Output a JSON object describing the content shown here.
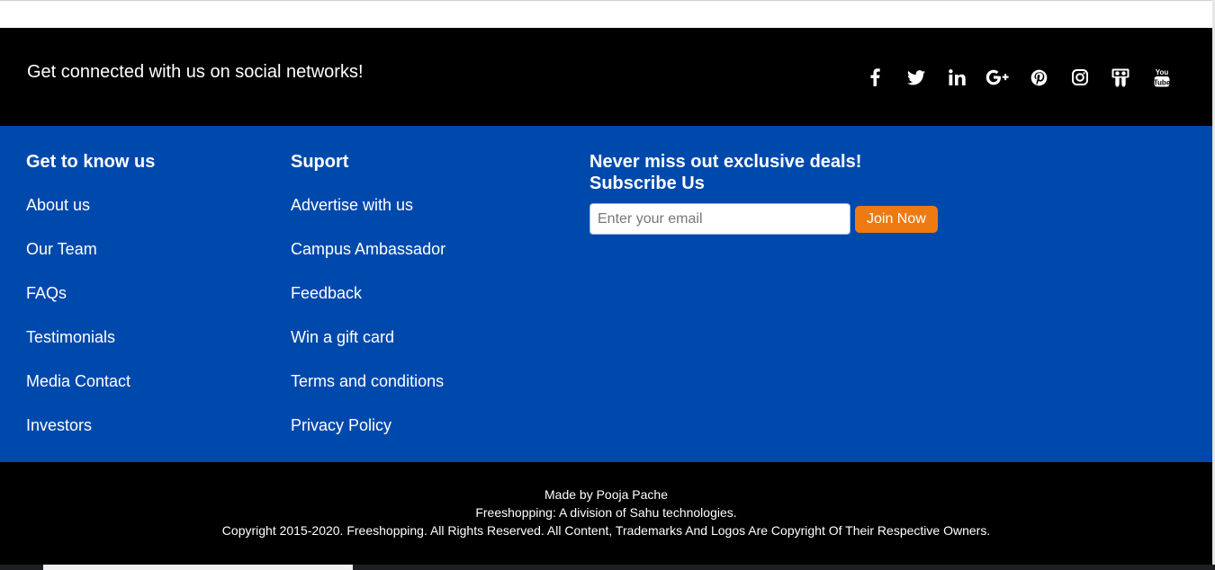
{
  "social": {
    "text": "Get connected with us on social networks!",
    "icons": [
      "facebook-icon",
      "twitter-icon",
      "linkedin-icon",
      "google-plus-icon",
      "pinterest-icon",
      "instagram-icon",
      "slideshare-icon",
      "youtube-icon"
    ]
  },
  "columns": {
    "know_us": {
      "heading": "Get to know us",
      "items": [
        "About us",
        "Our Team",
        "FAQs",
        "Testimonials",
        "Media Contact",
        "Investors"
      ]
    },
    "support": {
      "heading": "Suport",
      "items": [
        "Advertise with us",
        "Campus Ambassador",
        "Feedback",
        "Win a gift card",
        "Terms and conditions",
        "Privacy Policy"
      ]
    }
  },
  "newsletter": {
    "deals_heading": "Never miss out exclusive deals!",
    "subscribe_heading": "Subscribe Us",
    "email_placeholder": "Enter your email",
    "join_label": "Join Now"
  },
  "footer": {
    "made_by": "Made by Pooja Pache",
    "division": "Freeshopping: A division of Sahu technologies.",
    "copyright": "Copyright 2015-2020. Freeshopping. All Rights Reserved. All Content, Trademarks And Logos Are Copyright Of Their Respective Owners."
  },
  "colors": {
    "social_bar": "#000000",
    "links_section": "#0049ac",
    "join_button": "#ee7a12",
    "bottom_bar": "#000000"
  }
}
